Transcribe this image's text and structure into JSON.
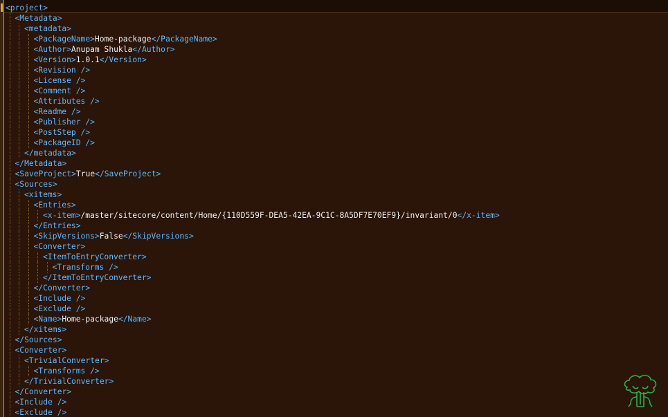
{
  "editor": {
    "lines": [
      {
        "indent": 0,
        "parts": [
          {
            "t": "<project>",
            "c": "tag"
          }
        ]
      },
      {
        "indent": 1,
        "parts": [
          {
            "t": "<Metadata>",
            "c": "tag"
          }
        ]
      },
      {
        "indent": 2,
        "parts": [
          {
            "t": "<metadata>",
            "c": "tag"
          }
        ]
      },
      {
        "indent": 3,
        "parts": [
          {
            "t": "<PackageName>",
            "c": "tag"
          },
          {
            "t": "Home-package",
            "c": "val"
          },
          {
            "t": "</PackageName>",
            "c": "tag"
          }
        ]
      },
      {
        "indent": 3,
        "parts": [
          {
            "t": "<Author>",
            "c": "tag"
          },
          {
            "t": "Anupam Shukla",
            "c": "val"
          },
          {
            "t": "</Author>",
            "c": "tag"
          }
        ]
      },
      {
        "indent": 3,
        "parts": [
          {
            "t": "<Version>",
            "c": "tag"
          },
          {
            "t": "1.0.1",
            "c": "val"
          },
          {
            "t": "</Version>",
            "c": "tag"
          }
        ]
      },
      {
        "indent": 3,
        "parts": [
          {
            "t": "<Revision />",
            "c": "tag"
          }
        ]
      },
      {
        "indent": 3,
        "parts": [
          {
            "t": "<License />",
            "c": "tag"
          }
        ]
      },
      {
        "indent": 3,
        "parts": [
          {
            "t": "<Comment />",
            "c": "tag"
          }
        ]
      },
      {
        "indent": 3,
        "parts": [
          {
            "t": "<Attributes />",
            "c": "tag"
          }
        ]
      },
      {
        "indent": 3,
        "parts": [
          {
            "t": "<Readme />",
            "c": "tag"
          }
        ]
      },
      {
        "indent": 3,
        "parts": [
          {
            "t": "<Publisher />",
            "c": "tag"
          }
        ]
      },
      {
        "indent": 3,
        "parts": [
          {
            "t": "<PostStep />",
            "c": "tag"
          }
        ]
      },
      {
        "indent": 3,
        "parts": [
          {
            "t": "<PackageID />",
            "c": "tag"
          }
        ]
      },
      {
        "indent": 2,
        "parts": [
          {
            "t": "</metadata>",
            "c": "tag"
          }
        ]
      },
      {
        "indent": 1,
        "parts": [
          {
            "t": "</Metadata>",
            "c": "tag"
          }
        ]
      },
      {
        "indent": 1,
        "parts": [
          {
            "t": "<SaveProject>",
            "c": "tag"
          },
          {
            "t": "True",
            "c": "val"
          },
          {
            "t": "</SaveProject>",
            "c": "tag"
          }
        ]
      },
      {
        "indent": 1,
        "parts": [
          {
            "t": "<Sources>",
            "c": "tag"
          }
        ]
      },
      {
        "indent": 2,
        "parts": [
          {
            "t": "<xitems>",
            "c": "tag"
          }
        ]
      },
      {
        "indent": 3,
        "parts": [
          {
            "t": "<Entries>",
            "c": "tag"
          }
        ]
      },
      {
        "indent": 4,
        "parts": [
          {
            "t": "<x-item>",
            "c": "tag"
          },
          {
            "t": "/master/sitecore/content/Home/{110D559F-DEA5-42EA-9C1C-8A5DF7E70EF9}/invariant/0",
            "c": "val"
          },
          {
            "t": "</x-item>",
            "c": "tag"
          }
        ]
      },
      {
        "indent": 3,
        "parts": [
          {
            "t": "</Entries>",
            "c": "tag"
          }
        ]
      },
      {
        "indent": 3,
        "parts": [
          {
            "t": "<SkipVersions>",
            "c": "tag"
          },
          {
            "t": "False",
            "c": "val"
          },
          {
            "t": "</SkipVersions>",
            "c": "tag"
          }
        ]
      },
      {
        "indent": 3,
        "parts": [
          {
            "t": "<Converter>",
            "c": "tag"
          }
        ]
      },
      {
        "indent": 4,
        "parts": [
          {
            "t": "<ItemToEntryConverter>",
            "c": "tag"
          }
        ]
      },
      {
        "indent": 5,
        "parts": [
          {
            "t": "<Transforms />",
            "c": "tag"
          }
        ]
      },
      {
        "indent": 4,
        "parts": [
          {
            "t": "</ItemToEntryConverter>",
            "c": "tag"
          }
        ]
      },
      {
        "indent": 3,
        "parts": [
          {
            "t": "</Converter>",
            "c": "tag"
          }
        ]
      },
      {
        "indent": 3,
        "parts": [
          {
            "t": "<Include />",
            "c": "tag"
          }
        ]
      },
      {
        "indent": 3,
        "parts": [
          {
            "t": "<Exclude />",
            "c": "tag"
          }
        ]
      },
      {
        "indent": 3,
        "parts": [
          {
            "t": "<Name>",
            "c": "tag"
          },
          {
            "t": "Home-package",
            "c": "val"
          },
          {
            "t": "</Name>",
            "c": "tag"
          }
        ]
      },
      {
        "indent": 2,
        "parts": [
          {
            "t": "</xitems>",
            "c": "tag"
          }
        ]
      },
      {
        "indent": 1,
        "parts": [
          {
            "t": "</Sources>",
            "c": "tag"
          }
        ]
      },
      {
        "indent": 1,
        "parts": [
          {
            "t": "<Converter>",
            "c": "tag"
          }
        ]
      },
      {
        "indent": 2,
        "parts": [
          {
            "t": "<TrivialConverter>",
            "c": "tag"
          }
        ]
      },
      {
        "indent": 3,
        "parts": [
          {
            "t": "<Transforms />",
            "c": "tag"
          }
        ]
      },
      {
        "indent": 2,
        "parts": [
          {
            "t": "</TrivialConverter>",
            "c": "tag"
          }
        ]
      },
      {
        "indent": 1,
        "parts": [
          {
            "t": "</Converter>",
            "c": "tag"
          }
        ]
      },
      {
        "indent": 1,
        "parts": [
          {
            "t": "<Include />",
            "c": "tag"
          }
        ]
      },
      {
        "indent": 1,
        "parts": [
          {
            "t": "<Exclude />",
            "c": "tag"
          }
        ]
      }
    ]
  },
  "logo": {
    "icon": "tree-icon"
  },
  "colors": {
    "background": "#2a1508",
    "tag": "#5cb8ff",
    "text": "#f0f0f0",
    "guide": "#8a6a30",
    "logo": "#2fb04a"
  }
}
